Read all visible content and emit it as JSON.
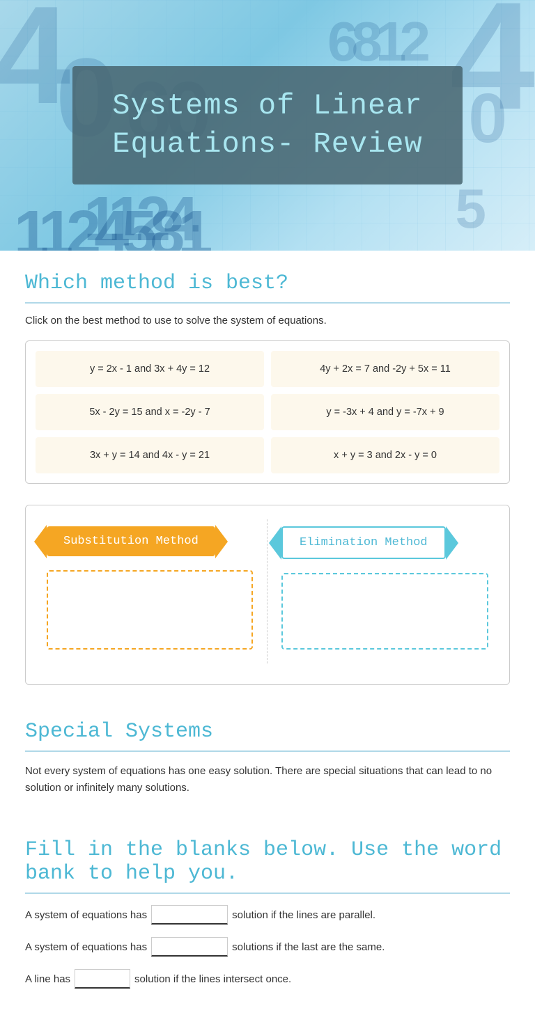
{
  "hero": {
    "title": "Systems of Linear Equations- Review",
    "numbers_display": [
      "4",
      "0",
      "60",
      "6812",
      "0",
      "1124581",
      "1124",
      "5",
      "24581"
    ]
  },
  "which_method": {
    "section_title": "Which method is best?",
    "instruction": "Click on the best method to use to solve the system of equations.",
    "equations": [
      {
        "id": "eq1",
        "text": "y = 2x - 1  and  3x + 4y = 12"
      },
      {
        "id": "eq2",
        "text": "4y + 2x = 7  and  -2y + 5x = 11"
      },
      {
        "id": "eq3",
        "text": "5x - 2y = 15  and x = -2y - 7"
      },
      {
        "id": "eq4",
        "text": "y = -3x + 4 and y = -7x + 9"
      },
      {
        "id": "eq5",
        "text": "3x + y = 14  and  4x - y = 21"
      },
      {
        "id": "eq6",
        "text": "x + y = 3  and  2x - y = 0"
      }
    ]
  },
  "methods": {
    "substitution_label": "Substitution Method",
    "elimination_label": "Elimination Method"
  },
  "special_systems": {
    "section_title": "Special Systems",
    "body_text": "Not every system of equations has one easy solution.  There are special situations that can lead to no solution or infinitely many solutions."
  },
  "fill_blanks": {
    "section_title": "Fill in the blanks below. Use the word bank to help you.",
    "lines": [
      {
        "prefix": "A system of equations has",
        "suffix": "solution if the lines are parallel.",
        "blank_placeholder": ""
      },
      {
        "prefix": "A system of equations has",
        "suffix": "solutions if the last are the same.",
        "blank_placeholder": ""
      },
      {
        "prefix": "A line has",
        "suffix": "solution if the lines intersect once.",
        "blank_placeholder": "",
        "small": true
      }
    ]
  }
}
